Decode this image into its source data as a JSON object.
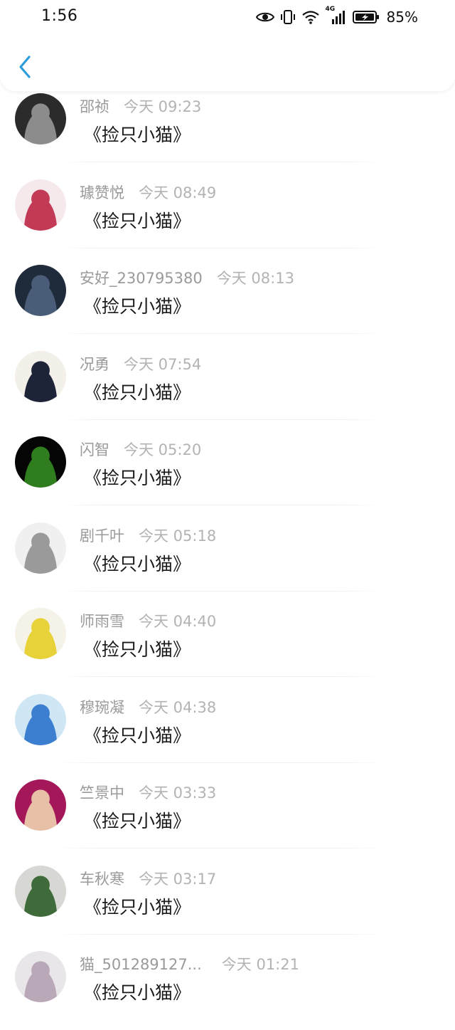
{
  "status_bar": {
    "time": "1:56",
    "network_label": "4G",
    "battery_percent": "85%"
  },
  "header": {
    "back_icon": "chevron-left-icon",
    "accent_color": "#2d9cdb"
  },
  "comments": [
    {
      "user": "邵祯",
      "time": "今天 09:23",
      "message": "《捡只小猫》",
      "avatar_colors": [
        "#2b2b2b",
        "#8c8c8c"
      ]
    },
    {
      "user": "璩赞悦",
      "time": "今天 08:49",
      "message": "《捡只小猫》",
      "avatar_colors": [
        "#f5e9ec",
        "#c23a55"
      ]
    },
    {
      "user": "安好_230795380",
      "time": "今天 08:13",
      "message": "《捡只小猫》",
      "avatar_colors": [
        "#1f2a3a",
        "#4a5d78"
      ]
    },
    {
      "user": "况勇",
      "time": "今天 07:54",
      "message": "《捡只小猫》",
      "avatar_colors": [
        "#f3efe9",
        "#1e2438"
      ]
    },
    {
      "user": "闪智",
      "time": "今天 05:20",
      "message": "《捡只小猫》",
      "avatar_colors": [
        "#050505",
        "#2f7d1f"
      ]
    },
    {
      "user": "剧千叶",
      "time": "今天 05:18",
      "message": "《捡只小猫》",
      "avatar_colors": [
        "#f0f0f0",
        "#9a9a9a"
      ]
    },
    {
      "user": "师雨雪",
      "time": "今天 04:40",
      "message": "《捡只小猫》",
      "avatar_colors": [
        "#f5f2e8",
        "#e8d23a"
      ]
    },
    {
      "user": "穆琬凝",
      "time": "今天 04:38",
      "message": "《捡只小猫》",
      "avatar_colors": [
        "#cfe6f4",
        "#3c7fd0"
      ]
    },
    {
      "user": "竺景中",
      "time": "今天 03:33",
      "message": "《捡只小猫》",
      "avatar_colors": [
        "#a4185a",
        "#e8c0a8"
      ]
    },
    {
      "user": "车秋寒",
      "time": "今天 03:17",
      "message": "《捡只小猫》",
      "avatar_colors": [
        "#d7d7d3",
        "#3f6a3a"
      ]
    },
    {
      "user": "猫_501289127...",
      "time": "今天 01:21",
      "message": "《捡只小猫》",
      "avatar_colors": [
        "#e9e6ea",
        "#b9a9b8"
      ]
    }
  ]
}
